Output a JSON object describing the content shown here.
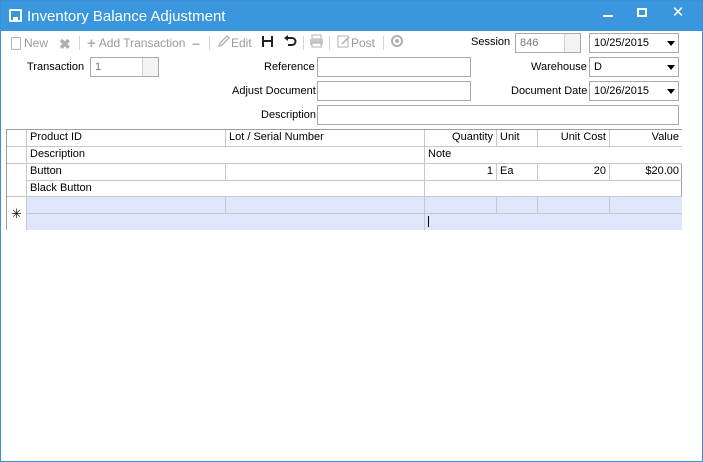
{
  "window": {
    "title": "Inventory Balance Adjustment"
  },
  "toolbar": {
    "new_label": "New",
    "add_transaction_label": "Add Transaction",
    "edit_label": "Edit",
    "post_label": "Post"
  },
  "header": {
    "session_label": "Session",
    "session_value": "846",
    "session_date": "10/25/2015",
    "transaction_label": "Transaction",
    "transaction_value": "1",
    "reference_label": "Reference",
    "reference_value": "",
    "adjust_document_label": "Adjust Document",
    "adjust_document_value": "",
    "description_label": "Description",
    "description_value": "",
    "warehouse_label": "Warehouse",
    "warehouse_value": "D",
    "document_date_label": "Document Date",
    "document_date_value": "10/26/2015"
  },
  "grid": {
    "columns": {
      "product_id": "Product ID",
      "lot_serial": "Lot / Serial Number",
      "quantity": "Quantity",
      "unit": "Unit",
      "unit_cost": "Unit Cost",
      "value": "Value",
      "description": "Description",
      "note": "Note"
    },
    "rows": [
      {
        "product_id": "Button",
        "lot_serial": "",
        "quantity": "1",
        "unit": "Ea",
        "unit_cost": "20",
        "value": "$20.00",
        "description": "Black Button",
        "note": ""
      }
    ],
    "new_row_marker": "✳"
  },
  "colors": {
    "titlebar": "#3a96dd",
    "new_row": "#dde6fa"
  }
}
